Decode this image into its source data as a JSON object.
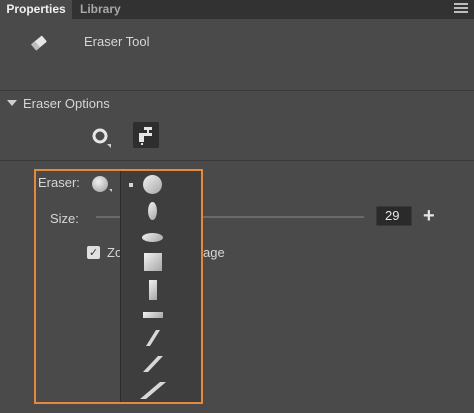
{
  "tabs": [
    {
      "label": "Properties",
      "active": true
    },
    {
      "label": "Library",
      "active": false
    }
  ],
  "tool": {
    "name": "Eraser Tool",
    "icon": "eraser-icon"
  },
  "section": {
    "title": "Eraser Options",
    "expanded": true
  },
  "eraser": {
    "label": "Eraser:",
    "selected_shape": "circle-large"
  },
  "size": {
    "label": "Size:",
    "value": "29",
    "plus": "+"
  },
  "zoom": {
    "label_visible_start": "Zo",
    "label_visible_end": "age",
    "checked": true
  },
  "dropdown": {
    "shapes": [
      "circle-large",
      "ellipse-vertical",
      "ellipse-horizontal",
      "square",
      "rectangle-vertical",
      "rectangle-horizontal",
      "slash-small",
      "slash-medium",
      "slash-large"
    ]
  },
  "colors": {
    "highlight": "#e58a3a",
    "panel_bg": "#4a4a4a",
    "tabbar_bg": "#323232"
  }
}
